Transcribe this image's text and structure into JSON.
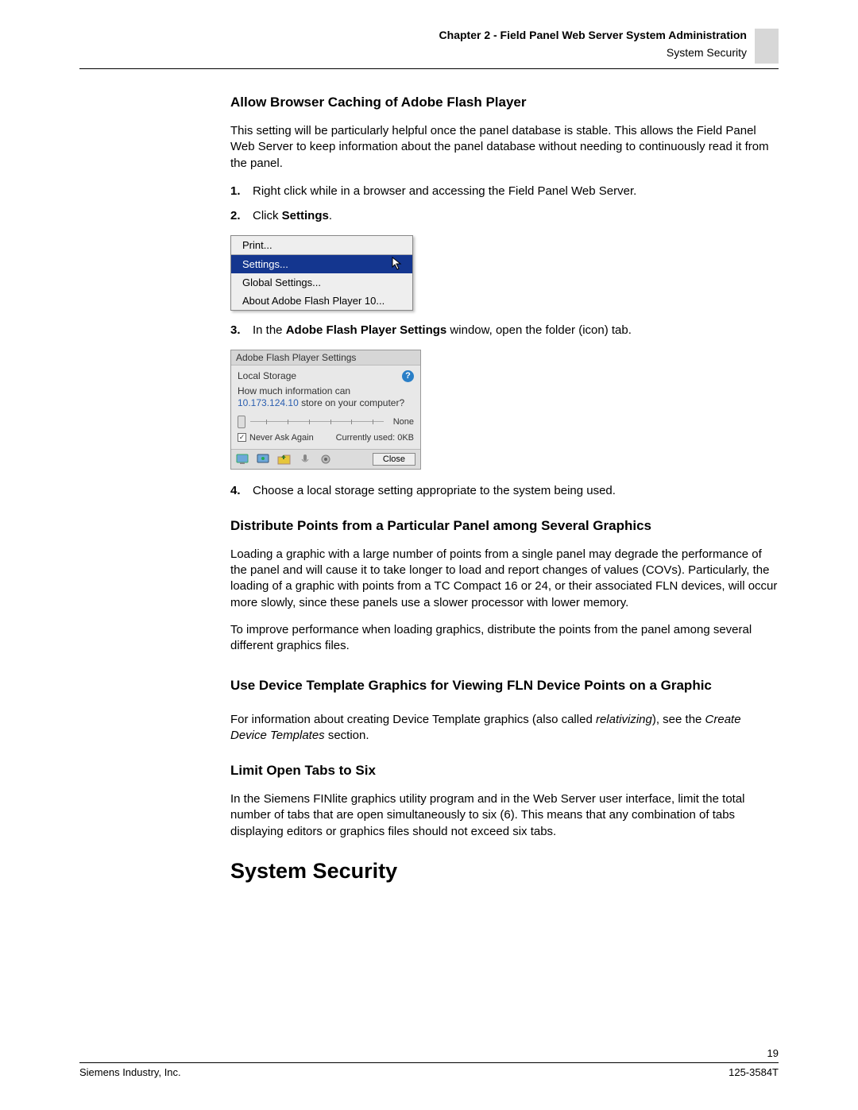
{
  "header": {
    "chapter": "Chapter 2 - Field Panel Web Server System Administration",
    "sub": "System Security"
  },
  "sections": {
    "allow_caching": {
      "title": "Allow Browser Caching of Adobe Flash Player",
      "intro": "This setting will be particularly helpful once the panel database is stable. This allows the Field Panel Web Server to keep information about the panel database without needing to continuously read it from the panel.",
      "step1": "Right click while in a browser and accessing the Field Panel Web Server.",
      "step2_pre": "Click ",
      "step2_bold": "Settings",
      "step2_post": ".",
      "step3_pre": "In the ",
      "step3_bold": "Adobe Flash Player Settings",
      "step3_post": " window, open the folder (icon) tab.",
      "step4": "Choose a local storage setting appropriate to the system being used."
    },
    "ctxmenu": {
      "print": "Print...",
      "settings": "Settings...",
      "global": "Global Settings...",
      "about": "About Adobe Flash Player 10..."
    },
    "flashdlg": {
      "title": "Adobe Flash Player Settings",
      "local_storage": "Local Storage",
      "question_pre": "How much information can",
      "ip": "10.173.124.10",
      "question_post": " store on your computer?",
      "none": "None",
      "never_ask": "Never Ask Again",
      "used": "Currently used: 0KB",
      "close": "Close"
    },
    "distribute": {
      "title": "Distribute Points from a Particular Panel among Several Graphics",
      "p1": "Loading a graphic with a large number of points from a single panel may degrade the performance of the panel and will cause it to take longer to load and report changes of values (COVs). Particularly, the loading of a graphic with points from a TC Compact 16 or 24, or their associated FLN devices, will occur more slowly, since these panels use a slower processor with lower memory.",
      "p2": "To improve performance when loading graphics, distribute the points from the panel among several different graphics files."
    },
    "device_template": {
      "title": "Use Device Template Graphics for Viewing FLN Device Points on a Graphic",
      "p_pre": "For information about creating Device Template graphics (also called ",
      "p_italic1": "relativizing",
      "p_mid": "), see the ",
      "p_italic2": "Create Device Templates",
      "p_post": " section."
    },
    "limit_tabs": {
      "title": "Limit Open Tabs to Six",
      "p": "In the Siemens FINlite graphics utility program and in the Web Server user interface, limit the total number of tabs that are open simultaneously to six (6). This means that any combination of tabs displaying editors or graphics files should not exceed six tabs."
    }
  },
  "main_heading": "System Security",
  "footer": {
    "page": "19",
    "left": "Siemens Industry, Inc.",
    "right": "125-3584T"
  },
  "nums": {
    "n1": "1.",
    "n2": "2.",
    "n3": "3.",
    "n4": "4."
  }
}
